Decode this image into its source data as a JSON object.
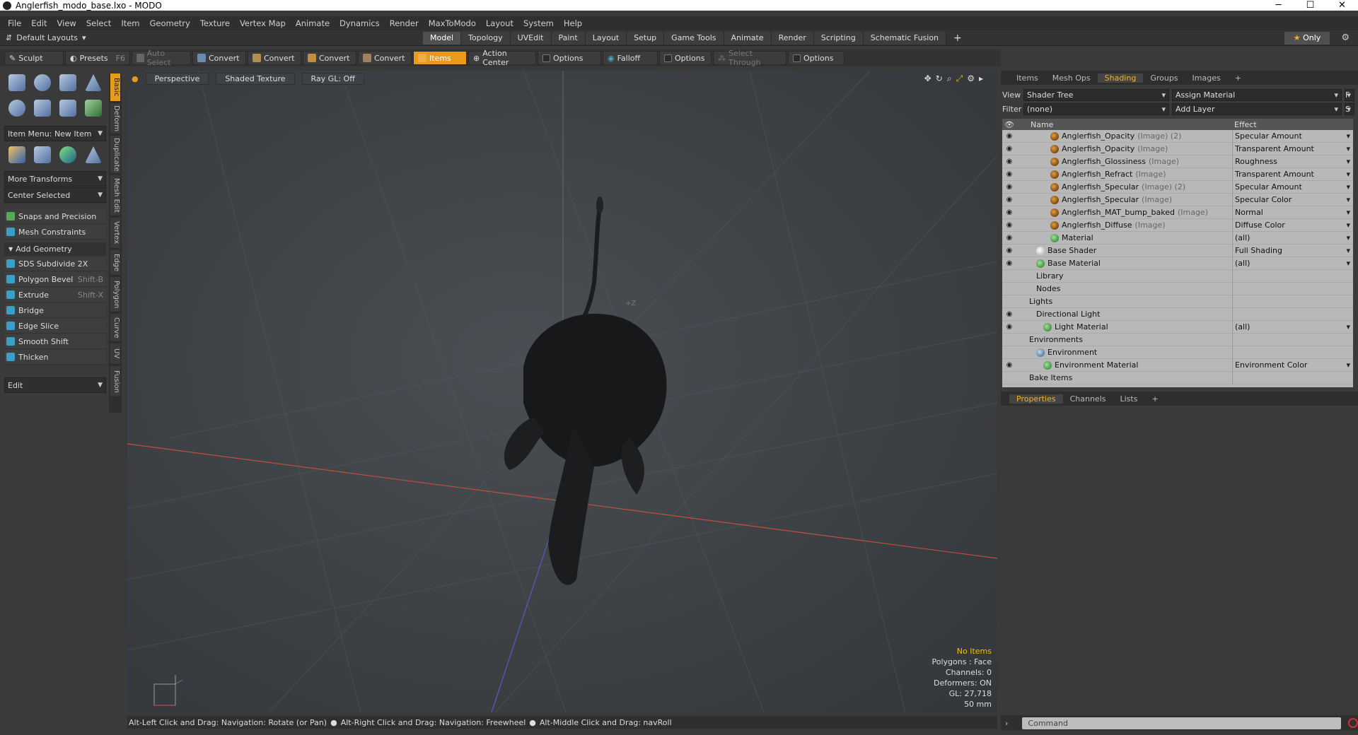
{
  "window": {
    "title": "Anglerfish_modo_base.lxo - MODO",
    "minimize": "─",
    "maximize": "☐",
    "close": "✕"
  },
  "menu": [
    "File",
    "Edit",
    "View",
    "Select",
    "Item",
    "Geometry",
    "Texture",
    "Vertex Map",
    "Animate",
    "Dynamics",
    "Render",
    "MaxToModo",
    "Layout",
    "System",
    "Help"
  ],
  "layouts": {
    "label": "Default Layouts",
    "tabs": [
      "Model",
      "Topology",
      "UVEdit",
      "Paint",
      "Layout",
      "Setup",
      "Game Tools",
      "Animate",
      "Render",
      "Scripting",
      "Schematic Fusion"
    ],
    "active": "Model",
    "only": "Only"
  },
  "toolbar": {
    "sculpt": "Sculpt",
    "presets": "Presets",
    "presets_key": "F6",
    "auto_select": "Auto Select",
    "convert": "Convert",
    "items": "Items",
    "action_center": "Action Center",
    "options": "Options",
    "falloff": "Falloff",
    "select_through": "Select Through"
  },
  "left": {
    "item_menu": "Item Menu: New Item",
    "more_transforms": "More Transforms",
    "center_selected": "Center Selected",
    "snaps": "Snaps and Precision",
    "mesh_constraints": "Mesh Constraints",
    "add_geometry": "Add Geometry",
    "tools": [
      {
        "label": "SDS Subdivide 2X",
        "key": ""
      },
      {
        "label": "Polygon Bevel",
        "key": "Shift-B"
      },
      {
        "label": "Extrude",
        "key": "Shift-X"
      },
      {
        "label": "Bridge",
        "key": ""
      },
      {
        "label": "Edge Slice",
        "key": ""
      },
      {
        "label": "Smooth Shift",
        "key": ""
      },
      {
        "label": "Thicken",
        "key": ""
      }
    ],
    "edit": "Edit",
    "vtabs": [
      "Basic",
      "Deform",
      "Duplicate",
      "Mesh Edit",
      "Vertex",
      "Edge",
      "Polygon",
      "Curve",
      "UV",
      "Fusion"
    ]
  },
  "viewport": {
    "perspective": "Perspective",
    "shading": "Shaded Texture",
    "raygl": "Ray GL: Off",
    "axis_label": "+Z",
    "stats": {
      "items": "No Items",
      "polygons": "Polygons : Face",
      "channels": "Channels: 0",
      "deformers": "Deformers: ON",
      "gl": "GL: 27,718",
      "scale": "50 mm"
    }
  },
  "status": {
    "hint1": "Alt-Left Click and Drag: Navigation: Rotate (or Pan)",
    "hint2": "Alt-Right Click and Drag: Navigation: Freewheel",
    "hint3": "Alt-Middle Click and Drag: navRoll"
  },
  "right": {
    "tabs": [
      "Items",
      "Mesh Ops",
      "Shading",
      "Groups",
      "Images"
    ],
    "active": "Shading",
    "view_label": "View",
    "view_value": "Shader Tree",
    "assign": "Assign Material",
    "filter_label": "Filter",
    "filter_value": "(none)",
    "add_layer": "Add Layer",
    "col_name": "Name",
    "col_effect": "Effect",
    "rows": [
      {
        "name": "Anglerfish_Opacity",
        "type": "(Image) (2)",
        "effect": "Specular Amount",
        "icon": "img",
        "indent": 4,
        "eye": true
      },
      {
        "name": "Anglerfish_Opacity",
        "type": "(Image)",
        "effect": "Transparent Amount",
        "icon": "img",
        "indent": 4,
        "eye": true
      },
      {
        "name": "Anglerfish_Glossiness",
        "type": "(Image)",
        "effect": "Roughness",
        "icon": "img",
        "indent": 4,
        "eye": true
      },
      {
        "name": "Anglerfish_Refract",
        "type": "(Image)",
        "effect": "Transparent Amount",
        "icon": "img",
        "indent": 4,
        "eye": true
      },
      {
        "name": "Anglerfish_Specular",
        "type": "(Image) (2)",
        "effect": "Specular Amount",
        "icon": "img",
        "indent": 4,
        "eye": true
      },
      {
        "name": "Anglerfish_Specular",
        "type": "(Image)",
        "effect": "Specular Color",
        "icon": "img",
        "indent": 4,
        "eye": true
      },
      {
        "name": "Anglerfish_MAT_bump_baked",
        "type": "(Image)",
        "effect": "Normal",
        "icon": "img",
        "indent": 4,
        "eye": true
      },
      {
        "name": "Anglerfish_Diffuse",
        "type": "(Image)",
        "effect": "Diffuse Color",
        "icon": "img",
        "indent": 4,
        "eye": true
      },
      {
        "name": "Material",
        "type": "",
        "effect": "(all)",
        "icon": "mat",
        "indent": 4,
        "eye": true
      },
      {
        "name": "Base Shader",
        "type": "",
        "effect": "Full Shading",
        "icon": "sh",
        "indent": 2,
        "eye": true
      },
      {
        "name": "Base Material",
        "type": "",
        "effect": "(all)",
        "icon": "mat",
        "indent": 2,
        "eye": true
      },
      {
        "name": "Library",
        "type": "",
        "effect": "",
        "icon": "",
        "indent": 2,
        "eye": false
      },
      {
        "name": "Nodes",
        "type": "",
        "effect": "",
        "icon": "",
        "indent": 2,
        "eye": false
      },
      {
        "name": "Lights",
        "type": "",
        "effect": "",
        "icon": "",
        "indent": 1,
        "eye": false
      },
      {
        "name": "Directional Light",
        "type": "",
        "effect": "",
        "icon": "",
        "indent": 2,
        "eye": true
      },
      {
        "name": "Light Material",
        "type": "",
        "effect": "(all)",
        "icon": "mat",
        "indent": 3,
        "eye": true
      },
      {
        "name": "Environments",
        "type": "",
        "effect": "",
        "icon": "",
        "indent": 1,
        "eye": false
      },
      {
        "name": "Environment",
        "type": "",
        "effect": "",
        "icon": "env",
        "indent": 2,
        "eye": false
      },
      {
        "name": "Environment Material",
        "type": "",
        "effect": "Environment Color",
        "icon": "mat",
        "indent": 3,
        "eye": true
      },
      {
        "name": "Bake Items",
        "type": "",
        "effect": "",
        "icon": "",
        "indent": 1,
        "eye": false
      }
    ],
    "ptabs": [
      "Properties",
      "Channels",
      "Lists"
    ],
    "ptab_active": "Properties",
    "command_placeholder": "Command"
  }
}
